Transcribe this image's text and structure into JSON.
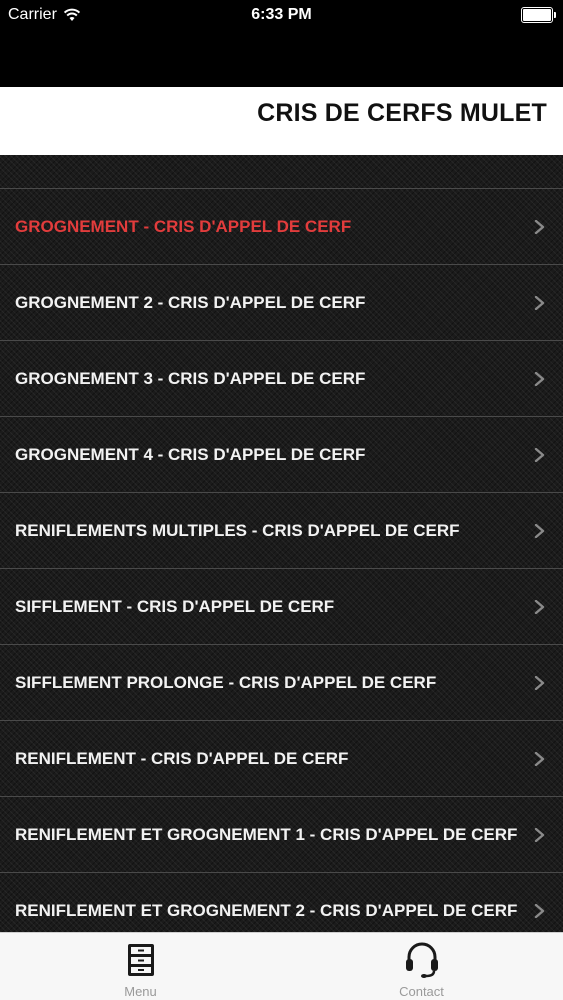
{
  "status_bar": {
    "carrier": "Carrier",
    "time": "6:33 PM",
    "icons": [
      "wifi-icon",
      "battery-icon"
    ]
  },
  "header": {
    "title": "CRIS DE CERFS MULET"
  },
  "list": {
    "active_color": "#e23c3c",
    "items": [
      {
        "label": "GROGNEMENT - CRIS D'APPEL DE CERF",
        "active": true
      },
      {
        "label": "GROGNEMENT 2 - CRIS D'APPEL DE CERF"
      },
      {
        "label": "GROGNEMENT 3 - CRIS D'APPEL DE CERF"
      },
      {
        "label": "GROGNEMENT 4 - CRIS D'APPEL DE CERF"
      },
      {
        "label": "RENIFLEMENTS MULTIPLES - CRIS D'APPEL DE CERF"
      },
      {
        "label": "SIFFLEMENT - CRIS D'APPEL DE CERF"
      },
      {
        "label": "SIFFLEMENT PROLONGE - CRIS D'APPEL DE CERF"
      },
      {
        "label": "RENIFLEMENT - CRIS D'APPEL DE CERF"
      },
      {
        "label": "RENIFLEMENT ET GROGNEMENT 1 - CRIS D'APPEL DE CERF"
      },
      {
        "label": "RENIFLEMENT ET GROGNEMENT 2 - CRIS D'APPEL DE CERF"
      }
    ]
  },
  "tabbar": {
    "tabs": [
      {
        "label": "Menu",
        "icon": "filing-cabinet-icon"
      },
      {
        "label": "Contact",
        "icon": "headset-icon"
      }
    ]
  }
}
